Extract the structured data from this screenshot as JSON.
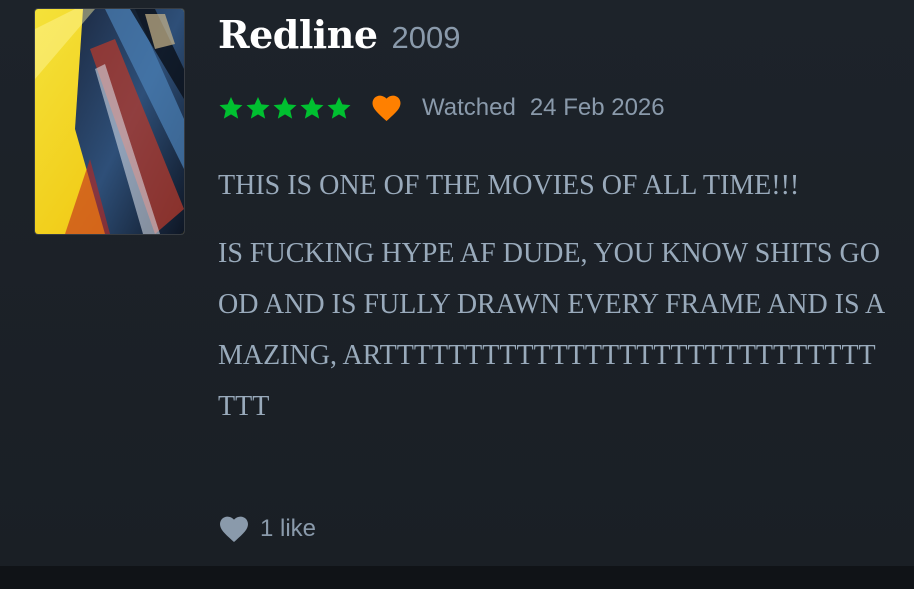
{
  "review": {
    "film": {
      "title": "Redline",
      "year": "2009",
      "poster_alt": "REDLINE"
    },
    "rating": {
      "stars": 5,
      "max_stars": 5,
      "star_color": "#00c030"
    },
    "liked": true,
    "liked_color": "#ff8000",
    "watched_label": "Watched",
    "watched_date": "24 Feb 2026",
    "paragraphs": [
      "THIS IS ONE OF THE MOVIES OF ALL TIME!!!",
      "IS FUCKING HYPE AF DUDE, YOU KNOW SHITS GOOD AND IS FULLY DRAWN EVERY FRAME AND IS AMAZING, ARTTTTTTTTTTTTTTTTTTTTTTTTTTTTTTTT"
    ],
    "like_icon": "heart-icon",
    "like_count_label": "1 like"
  }
}
